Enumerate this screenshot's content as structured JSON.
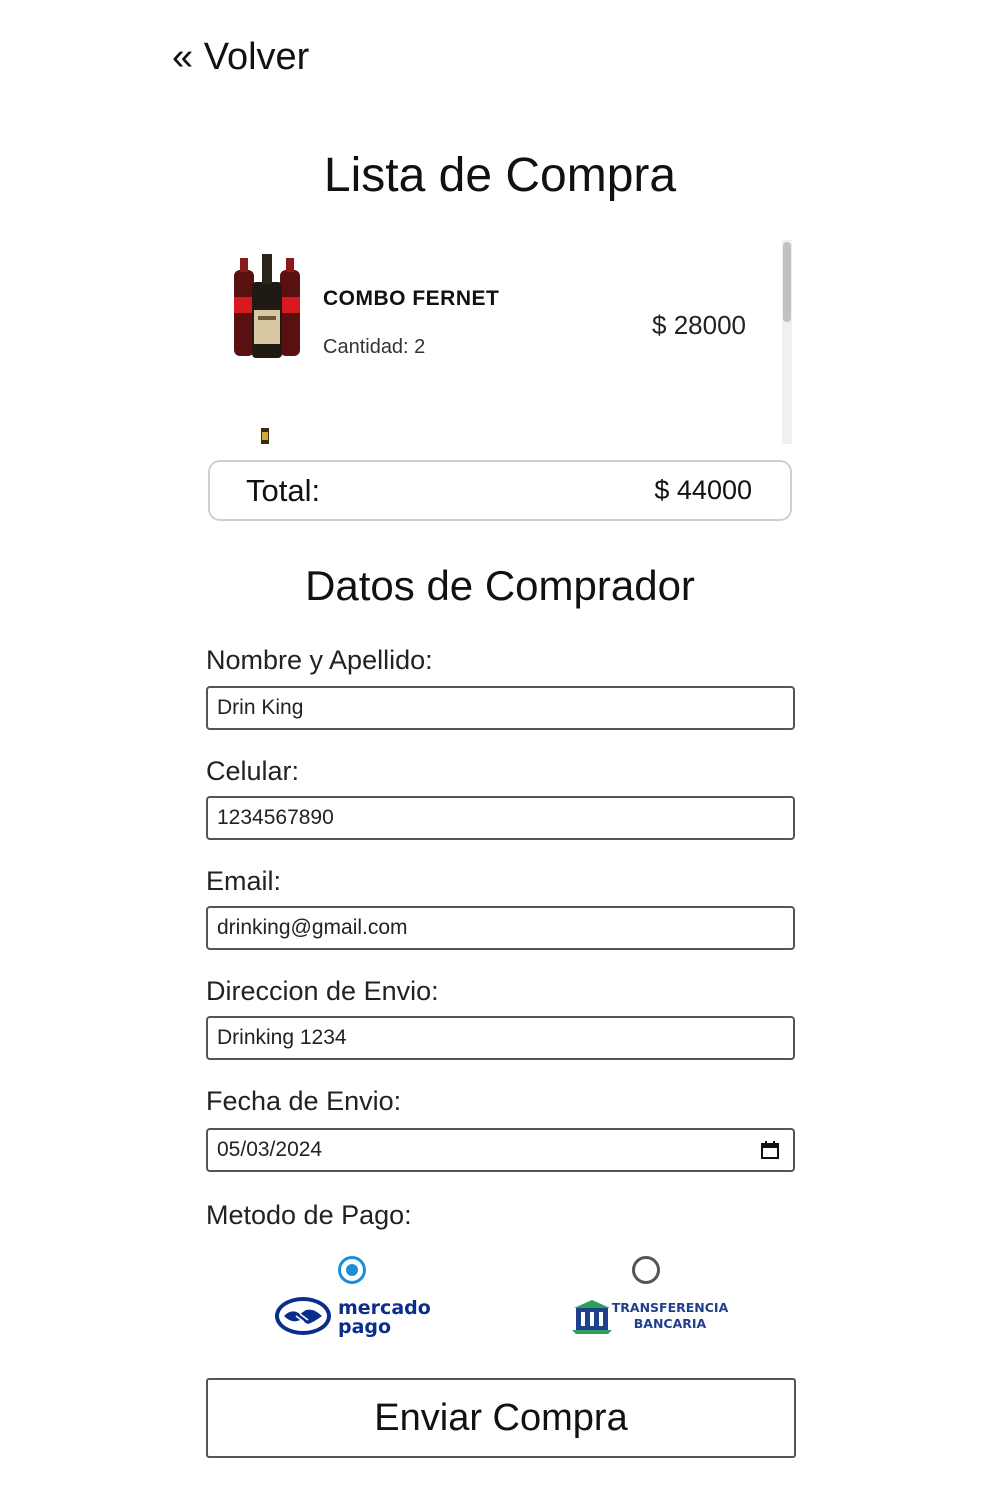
{
  "nav": {
    "back_label": "« Volver"
  },
  "cart": {
    "title": "Lista de Compra",
    "items": [
      {
        "name": "COMBO FERNET",
        "quantity": "Cantidad: 2",
        "price": "$ 28000"
      }
    ],
    "total_label": "Total:",
    "total_value": "$ 44000"
  },
  "buyer": {
    "title": "Datos de Comprador",
    "fields": {
      "name": {
        "label": "Nombre y Apellido:",
        "value": "Drin King"
      },
      "phone": {
        "label": "Celular:",
        "value": "1234567890"
      },
      "email": {
        "label": "Email:",
        "value": "drinking@gmail.com"
      },
      "address": {
        "label": "Direccion de Envio:",
        "value": "Drinking 1234"
      },
      "date": {
        "label": "Fecha de Envio:",
        "value": "05/03/2024"
      }
    },
    "payment": {
      "label": "Metodo de Pago:",
      "options": [
        {
          "brand_line1": "mercado",
          "brand_line2": "pago",
          "selected": true
        },
        {
          "brand_line1": "TRANSFERENCIA",
          "brand_line2": "BANCARIA",
          "selected": false
        }
      ]
    }
  },
  "submit_label": "Enviar Compra",
  "colors": {
    "accent": "#1a8fd8",
    "mp_blue": "#0a2d8c",
    "tb_green": "#2e9e5b"
  },
  "icons": [
    "calendar-icon",
    "handshake-icon",
    "bank-icon"
  ]
}
